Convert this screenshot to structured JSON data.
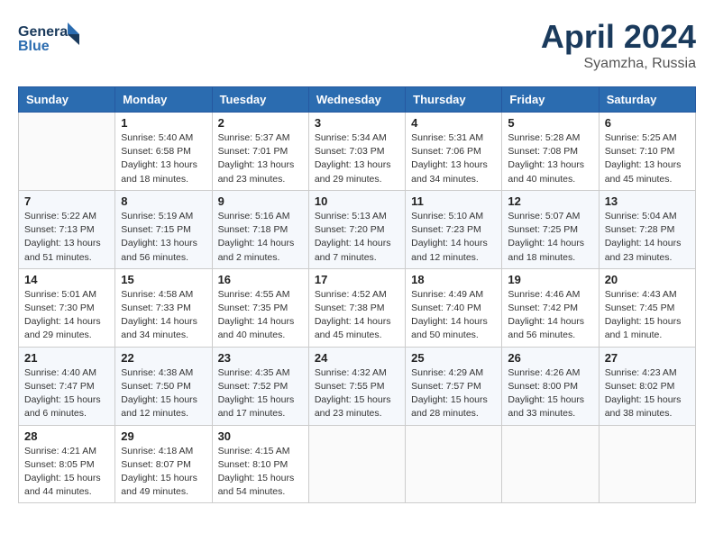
{
  "header": {
    "logo_line1": "General",
    "logo_line2": "Blue",
    "month_title": "April 2024",
    "subtitle": "Syamzha, Russia"
  },
  "columns": [
    "Sunday",
    "Monday",
    "Tuesday",
    "Wednesday",
    "Thursday",
    "Friday",
    "Saturday"
  ],
  "weeks": [
    [
      {
        "day": "",
        "info": ""
      },
      {
        "day": "1",
        "info": "Sunrise: 5:40 AM\nSunset: 6:58 PM\nDaylight: 13 hours\nand 18 minutes."
      },
      {
        "day": "2",
        "info": "Sunrise: 5:37 AM\nSunset: 7:01 PM\nDaylight: 13 hours\nand 23 minutes."
      },
      {
        "day": "3",
        "info": "Sunrise: 5:34 AM\nSunset: 7:03 PM\nDaylight: 13 hours\nand 29 minutes."
      },
      {
        "day": "4",
        "info": "Sunrise: 5:31 AM\nSunset: 7:06 PM\nDaylight: 13 hours\nand 34 minutes."
      },
      {
        "day": "5",
        "info": "Sunrise: 5:28 AM\nSunset: 7:08 PM\nDaylight: 13 hours\nand 40 minutes."
      },
      {
        "day": "6",
        "info": "Sunrise: 5:25 AM\nSunset: 7:10 PM\nDaylight: 13 hours\nand 45 minutes."
      }
    ],
    [
      {
        "day": "7",
        "info": "Sunrise: 5:22 AM\nSunset: 7:13 PM\nDaylight: 13 hours\nand 51 minutes."
      },
      {
        "day": "8",
        "info": "Sunrise: 5:19 AM\nSunset: 7:15 PM\nDaylight: 13 hours\nand 56 minutes."
      },
      {
        "day": "9",
        "info": "Sunrise: 5:16 AM\nSunset: 7:18 PM\nDaylight: 14 hours\nand 2 minutes."
      },
      {
        "day": "10",
        "info": "Sunrise: 5:13 AM\nSunset: 7:20 PM\nDaylight: 14 hours\nand 7 minutes."
      },
      {
        "day": "11",
        "info": "Sunrise: 5:10 AM\nSunset: 7:23 PM\nDaylight: 14 hours\nand 12 minutes."
      },
      {
        "day": "12",
        "info": "Sunrise: 5:07 AM\nSunset: 7:25 PM\nDaylight: 14 hours\nand 18 minutes."
      },
      {
        "day": "13",
        "info": "Sunrise: 5:04 AM\nSunset: 7:28 PM\nDaylight: 14 hours\nand 23 minutes."
      }
    ],
    [
      {
        "day": "14",
        "info": "Sunrise: 5:01 AM\nSunset: 7:30 PM\nDaylight: 14 hours\nand 29 minutes."
      },
      {
        "day": "15",
        "info": "Sunrise: 4:58 AM\nSunset: 7:33 PM\nDaylight: 14 hours\nand 34 minutes."
      },
      {
        "day": "16",
        "info": "Sunrise: 4:55 AM\nSunset: 7:35 PM\nDaylight: 14 hours\nand 40 minutes."
      },
      {
        "day": "17",
        "info": "Sunrise: 4:52 AM\nSunset: 7:38 PM\nDaylight: 14 hours\nand 45 minutes."
      },
      {
        "day": "18",
        "info": "Sunrise: 4:49 AM\nSunset: 7:40 PM\nDaylight: 14 hours\nand 50 minutes."
      },
      {
        "day": "19",
        "info": "Sunrise: 4:46 AM\nSunset: 7:42 PM\nDaylight: 14 hours\nand 56 minutes."
      },
      {
        "day": "20",
        "info": "Sunrise: 4:43 AM\nSunset: 7:45 PM\nDaylight: 15 hours\nand 1 minute."
      }
    ],
    [
      {
        "day": "21",
        "info": "Sunrise: 4:40 AM\nSunset: 7:47 PM\nDaylight: 15 hours\nand 6 minutes."
      },
      {
        "day": "22",
        "info": "Sunrise: 4:38 AM\nSunset: 7:50 PM\nDaylight: 15 hours\nand 12 minutes."
      },
      {
        "day": "23",
        "info": "Sunrise: 4:35 AM\nSunset: 7:52 PM\nDaylight: 15 hours\nand 17 minutes."
      },
      {
        "day": "24",
        "info": "Sunrise: 4:32 AM\nSunset: 7:55 PM\nDaylight: 15 hours\nand 23 minutes."
      },
      {
        "day": "25",
        "info": "Sunrise: 4:29 AM\nSunset: 7:57 PM\nDaylight: 15 hours\nand 28 minutes."
      },
      {
        "day": "26",
        "info": "Sunrise: 4:26 AM\nSunset: 8:00 PM\nDaylight: 15 hours\nand 33 minutes."
      },
      {
        "day": "27",
        "info": "Sunrise: 4:23 AM\nSunset: 8:02 PM\nDaylight: 15 hours\nand 38 minutes."
      }
    ],
    [
      {
        "day": "28",
        "info": "Sunrise: 4:21 AM\nSunset: 8:05 PM\nDaylight: 15 hours\nand 44 minutes."
      },
      {
        "day": "29",
        "info": "Sunrise: 4:18 AM\nSunset: 8:07 PM\nDaylight: 15 hours\nand 49 minutes."
      },
      {
        "day": "30",
        "info": "Sunrise: 4:15 AM\nSunset: 8:10 PM\nDaylight: 15 hours\nand 54 minutes."
      },
      {
        "day": "",
        "info": ""
      },
      {
        "day": "",
        "info": ""
      },
      {
        "day": "",
        "info": ""
      },
      {
        "day": "",
        "info": ""
      }
    ]
  ]
}
